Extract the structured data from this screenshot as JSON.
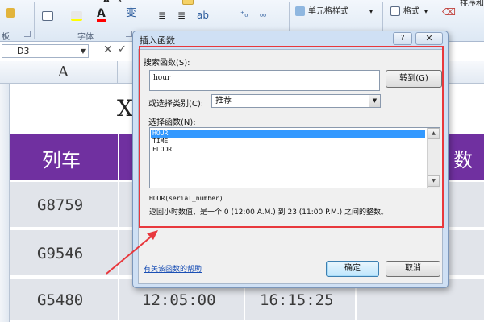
{
  "ribbon": {
    "font_group_label": "字体",
    "left_group_label": "板",
    "cell_styles_label": "单元格样式",
    "format_label": "格式",
    "sort_label": "排序和"
  },
  "formula_bar": {
    "name_box": "D3"
  },
  "sheet": {
    "col_a_header": "A",
    "title_partial": "X",
    "header_left": "列车",
    "header_right": "数",
    "rows": [
      {
        "train": "G8759",
        "time1": "",
        "time2": ""
      },
      {
        "train": "G9546",
        "time1": "",
        "time2": ""
      },
      {
        "train": "G5480",
        "time1": "12:05:00",
        "time2": "16:15:25"
      }
    ],
    "header_color": "#7030a0"
  },
  "dialog": {
    "title": "插入函数",
    "help_button": "?",
    "close_button": "✕",
    "search_label": "搜索函数(S):",
    "search_value": "hour",
    "goto_button": "转到(G)",
    "category_label": "或选择类别(C):",
    "category_value": "推荐",
    "select_label": "选择函数(N):",
    "functions": [
      "HOUR",
      "TIME",
      "FLOOR"
    ],
    "selected_function": "HOUR",
    "signature": "HOUR(serial_number)",
    "description": "返回小时数值，是一个 0 (12:00 A.M.) 到 23 (11:00 P.M.) 之间的整数。",
    "help_link": "有关该函数的帮助",
    "ok_button": "确定",
    "cancel_button": "取消"
  },
  "annotation": {
    "highlight_color": "#e8383d"
  }
}
